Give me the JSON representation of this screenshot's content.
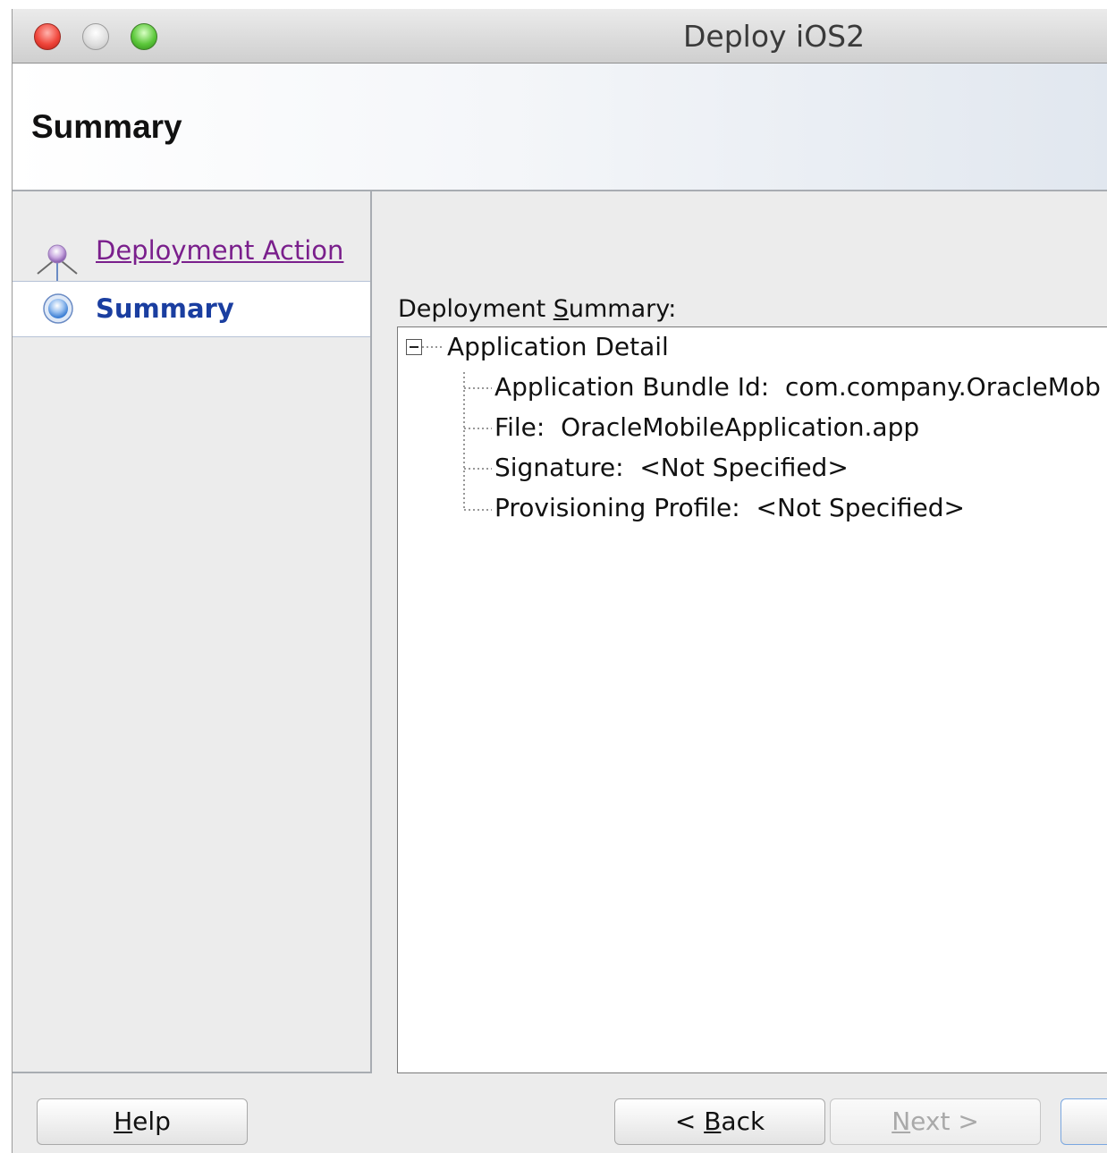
{
  "window": {
    "title": "Deploy iOS2"
  },
  "header": {
    "title": "Summary"
  },
  "nav": {
    "items": [
      {
        "label": "Deployment Action",
        "state": "visited-link"
      },
      {
        "label": "Summary",
        "state": "current"
      }
    ]
  },
  "content": {
    "label": "Deployment Summary:",
    "label_mnemonic": "S",
    "tree": {
      "root": "Application Detail",
      "children": [
        {
          "key": "Application Bundle Id:",
          "value": "com.company.OracleMob"
        },
        {
          "key": "File:",
          "value": "OracleMobileApplication.app"
        },
        {
          "key": "Signature:",
          "value": "<Not Specified>"
        },
        {
          "key": "Provisioning Profile:",
          "value": "<Not Specified>"
        }
      ]
    }
  },
  "footer": {
    "help": {
      "mnemonic": "H",
      "rest": "elp"
    },
    "back": {
      "prefix": "< ",
      "mnemonic": "B",
      "rest": "ack"
    },
    "next": {
      "mnemonic": "N",
      "rest": "ext >",
      "disabled": true
    }
  },
  "icons": {
    "close": "traffic-light-close",
    "minimize": "traffic-light-minimize",
    "zoom": "traffic-light-zoom",
    "step_done": "train-stop-visited-icon",
    "step_current": "train-stop-current-icon",
    "collapse": "tree-collapse-icon"
  },
  "colors": {
    "link": "#7a1f8c",
    "current": "#1a3ea0"
  }
}
